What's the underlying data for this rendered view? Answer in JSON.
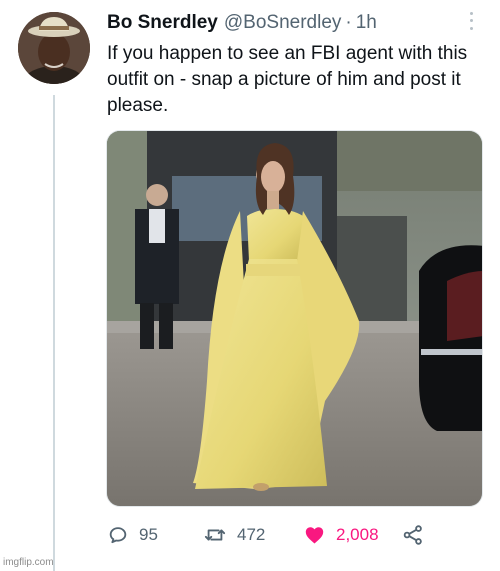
{
  "tweet": {
    "display_name": "Bo Snerdley",
    "handle": "@BoSnerdley",
    "separator": "·",
    "time": "1h",
    "text": "If you happen to see an FBI agent with this outfit on - snap a picture of him and post it please."
  },
  "actions": {
    "replies": "95",
    "retweets": "472",
    "likes": "2,008"
  },
  "colors": {
    "like_active": "#f91880",
    "secondary_text": "#536471"
  },
  "icons": {
    "reply": "reply-icon",
    "retweet": "retweet-icon",
    "like": "heart-icon",
    "share": "share-icon",
    "more": "more-icon"
  },
  "watermark": "imgflip.com"
}
